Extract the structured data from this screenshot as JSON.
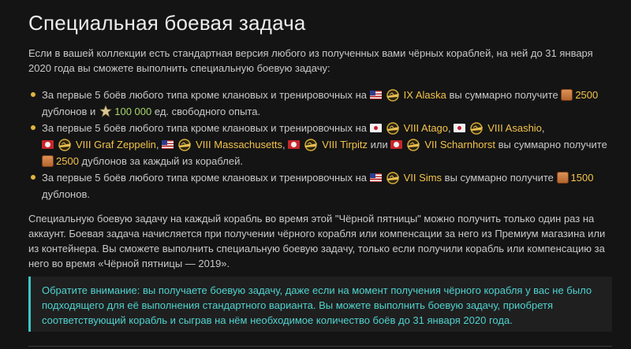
{
  "title": "Специальная боевая задача",
  "intro": "Если в вашей коллекции есть стандартная версия любого из полученных вами чёрных кораблей, на ней до 31 января 2020 года вы сможете выполнить специальную боевую задачу:",
  "tasks": [
    {
      "prefix": "За первые 5 боёв любого типа кроме клановых и тренировочных на",
      "ship": "IX Alaska",
      "mid": "вы суммарно получите",
      "gold": "2500",
      "tail1": "дублонов и",
      "xp": "100 000",
      "tail2": "ед. свободного опыта."
    },
    {
      "prefix": "За первые 5 боёв любого типа кроме клановых и тренировочных на",
      "ships": [
        "VIII Atago",
        "VIII Asashio",
        "VIII Graf Zeppelin",
        "VIII Massachusetts",
        "VIII Tirpitz",
        "VII Scharnhorst"
      ],
      "sep_comma": ",",
      "sep_or": "или",
      "mid": "вы суммарно получите",
      "gold": "2500",
      "tail": "дублонов за каждый из кораблей."
    },
    {
      "prefix": "За первые 5 боёв любого типа кроме клановых и тренировочных на",
      "ship": "VII Sims",
      "mid": "вы суммарно получите",
      "gold": "1500",
      "tail": "дублонов."
    }
  ],
  "paragraph": "Специальную боевую задачу на каждый корабль во время этой \"Чёрной пятницы\" можно получить только один раз на аккаунт. Боевая задача начисляется при получении чёрного корабля или компенсации за него из Премиум магазина или из контейнера. Вы сможете выполнить специальную боевую задачу, только если получили корабль или компенсацию за него во время «Чёрной пятницы — 2019».",
  "note": "Обратите внимание: вы получаете боевую задачу, даже если на момент получения чёрного корабля у вас не было подходящего для её выполнения стандартного варианта. Вы можете выполнить боевую задачу, приобретя соответствующий корабль и сыграв на нём необходимое количество боёв до 31 января 2020 года.",
  "icons": {
    "flag_us": "usa-flag-icon",
    "flag_jp": "japan-flag-icon",
    "flag_de": "germany-flag-icon",
    "ship_class": "ship-class-icon",
    "doubloon": "doubloon-icon",
    "free_xp": "free-xp-star-icon"
  },
  "colors": {
    "background": "#141414",
    "text": "#c8c8c8",
    "highlight": "#f3c34b",
    "xp": "#a6d66a",
    "note_accent": "#3bc7c4"
  }
}
